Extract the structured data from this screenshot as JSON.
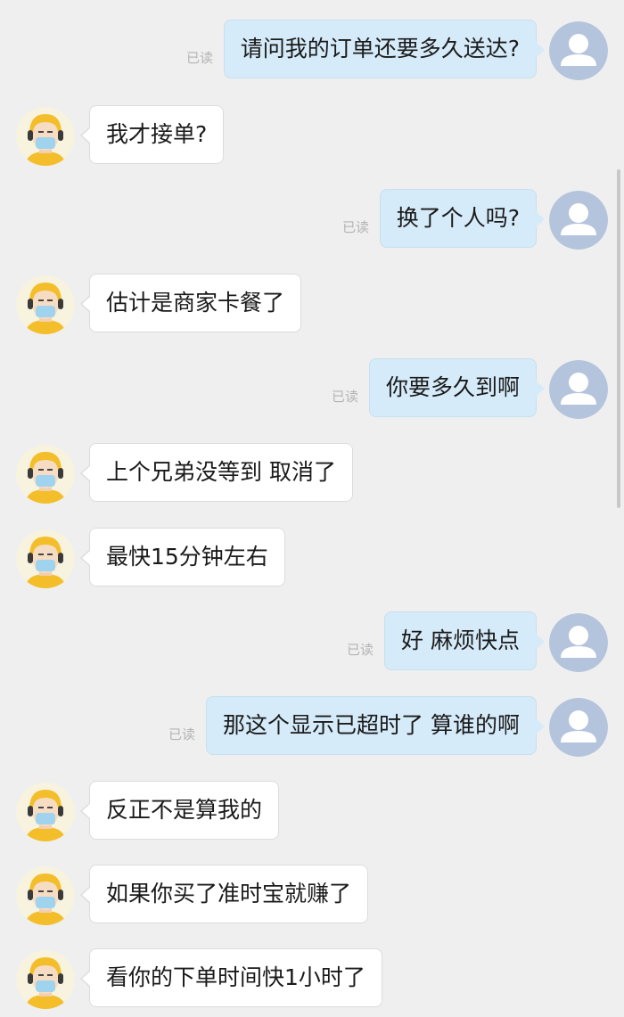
{
  "chat": {
    "messages": [
      {
        "side": "out",
        "text": "请问我的订单还要多久送达?",
        "status": "已读"
      },
      {
        "side": "in",
        "text": "我才接单?"
      },
      {
        "side": "out",
        "text": "换了个人吗?",
        "status": "已读"
      },
      {
        "side": "in",
        "text": "估计是商家卡餐了"
      },
      {
        "side": "out",
        "text": "你要多久到啊",
        "status": "已读"
      },
      {
        "side": "in",
        "text": "上个兄弟没等到 取消了"
      },
      {
        "side": "in",
        "text": "最快15分钟左右"
      },
      {
        "side": "out",
        "text": "好 麻烦快点",
        "status": "已读"
      },
      {
        "side": "out",
        "text": "那这个显示已超时了 算谁的啊",
        "status": "已读"
      },
      {
        "side": "in",
        "text": "反正不是算我的"
      },
      {
        "side": "in",
        "text": "如果你买了准时宝就赚了"
      },
      {
        "side": "in",
        "text": "看你的下单时间快1小时了"
      }
    ]
  },
  "icons": {
    "user_avatar": "default-user-avatar-icon",
    "courier_avatar": "courier-with-mask-avatar-icon"
  },
  "colors": {
    "background": "#efefef",
    "outgoing_bubble": "#d6ebf9",
    "incoming_bubble": "#ffffff",
    "avatar_default_bg": "#b3c4dc",
    "courier_helmet": "#f3be2a"
  }
}
